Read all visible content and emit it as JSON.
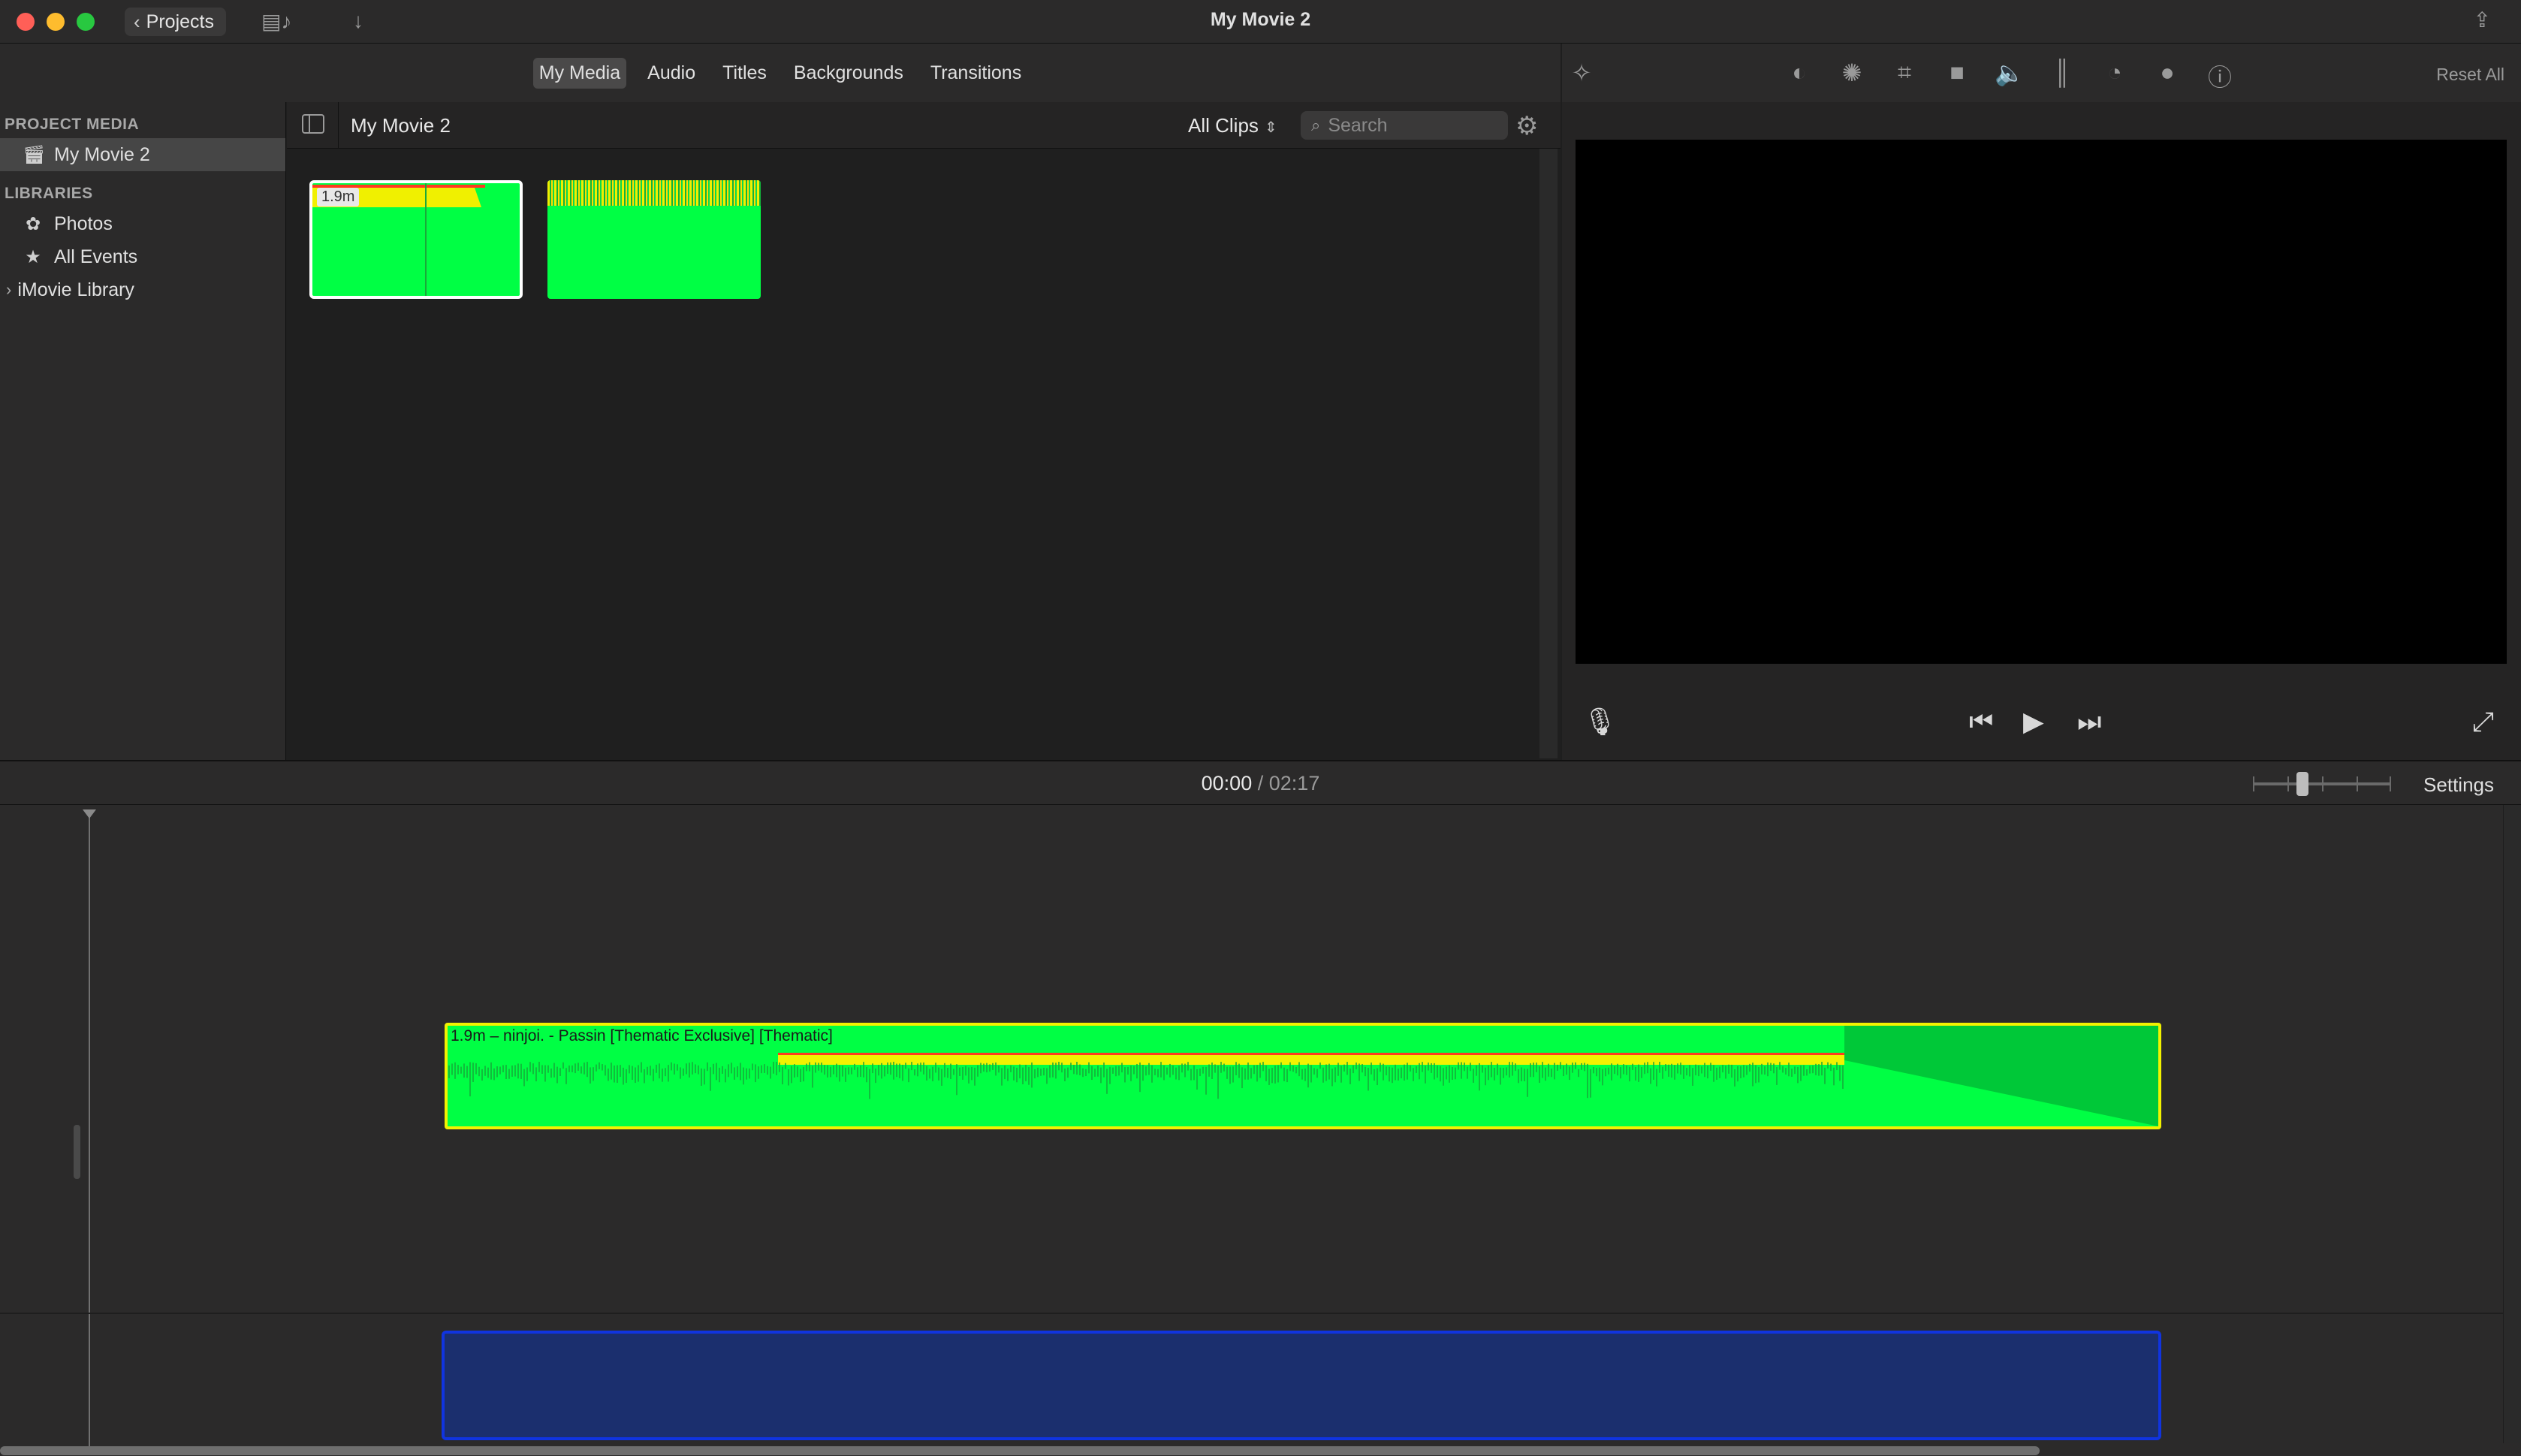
{
  "window": {
    "title": "My Movie 2",
    "projects_button": "Projects"
  },
  "media_tabs": [
    {
      "label": "My Media",
      "active": true
    },
    {
      "label": "Audio",
      "active": false
    },
    {
      "label": "Titles",
      "active": false
    },
    {
      "label": "Backgrounds",
      "active": false
    },
    {
      "label": "Transitions",
      "active": false
    }
  ],
  "inspector": {
    "tools": [
      "magic-wand-icon",
      "color-balance-icon",
      "color-correction-icon",
      "crop-icon",
      "stabilization-icon",
      "volume-icon",
      "noise-equalizer-icon",
      "speed-icon",
      "clip-filter-icon",
      "info-icon"
    ],
    "reset_all": "Reset All"
  },
  "sidebar": {
    "project_media_header": "PROJECT MEDIA",
    "project_items": [
      {
        "label": "My Movie 2",
        "icon": "clapper-icon",
        "active": true
      }
    ],
    "libraries_header": "LIBRARIES",
    "library_items": [
      {
        "label": "Photos",
        "icon": "photos-icon"
      },
      {
        "label": "All Events",
        "icon": "star-icon"
      }
    ],
    "imovie_library": "iMovie Library"
  },
  "browser": {
    "title": "My Movie 2",
    "filter": "All Clips",
    "search_placeholder": "Search",
    "clips": [
      {
        "duration_badge": "1.9m",
        "selected": true
      },
      {
        "duration_badge": "",
        "selected": false
      }
    ]
  },
  "timeline": {
    "current_time": "00:00",
    "separator": "/",
    "total_time": "02:17",
    "settings_label": "Settings",
    "music_clip_label": "1.9m – ninjoi. - Passin [Thematic Exclusive] [Thematic]"
  },
  "colors": {
    "audio_green": "#00ff44",
    "audio_peak_yellow": "#f2f200",
    "audio_clip_red": "#ff3b1f",
    "blue_clip": "#1b2f6e",
    "blue_clip_border": "#1034e0"
  }
}
